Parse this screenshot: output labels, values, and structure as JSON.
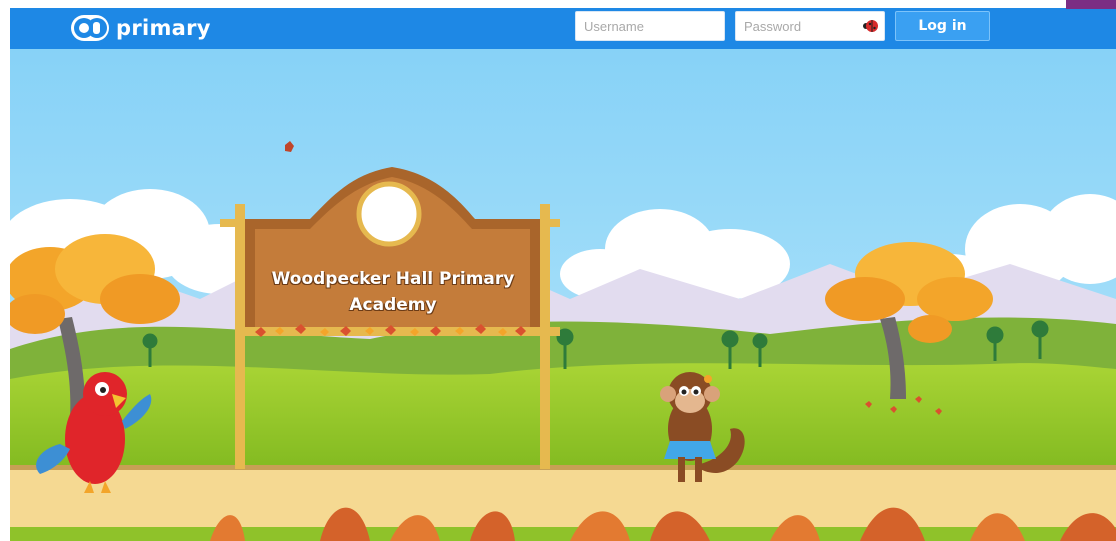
{
  "header": {
    "brand": "primary",
    "username_placeholder": "Username",
    "password_placeholder": "Password",
    "login_label": "Log in"
  },
  "scene": {
    "sign_text": "Woodpecker Hall Primary Academy"
  },
  "colors": {
    "header_bar": "#1e88e5",
    "login_button": "#3aa0f2",
    "sky": "#8fd6f8",
    "path": "#f5d992",
    "corner_tab": "#7b2e84"
  },
  "icons": [
    "logo-badge-icon",
    "ladybug-icon"
  ]
}
